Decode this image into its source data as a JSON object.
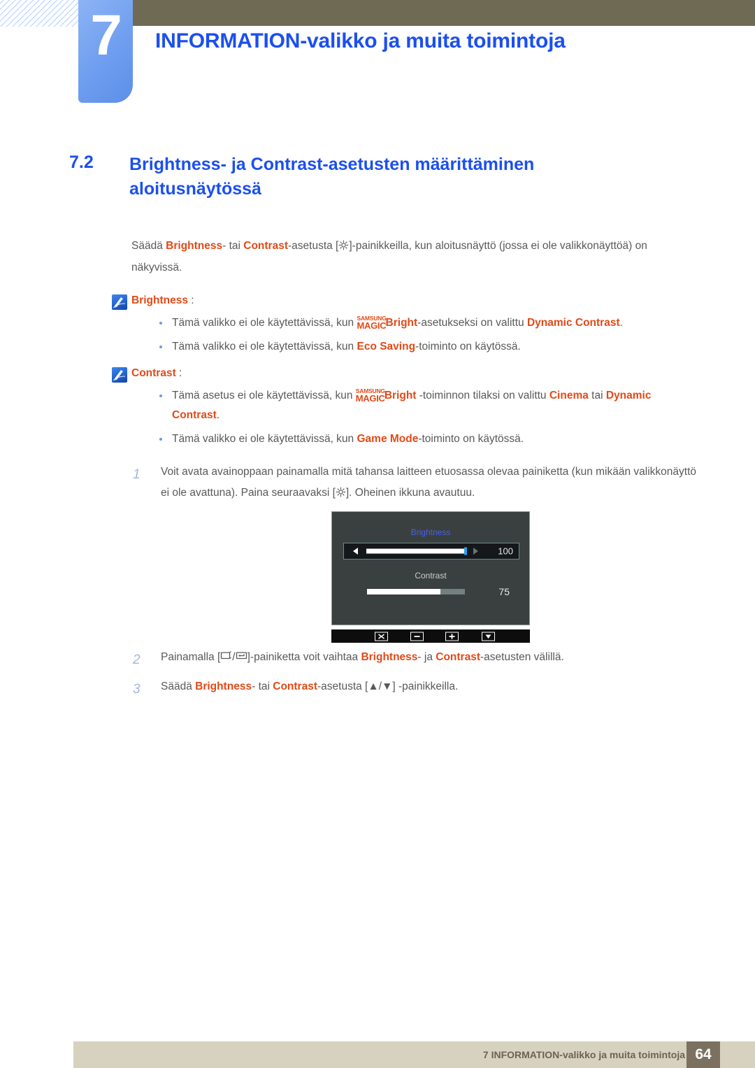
{
  "header": {
    "chapter_number": "7",
    "chapter_title": "INFORMATION-valikko ja muita toimintoja"
  },
  "section": {
    "number": "7.2",
    "title": "Brightness- ja Contrast-asetusten määrittäminen aloitusnäytössä"
  },
  "intro": {
    "p1_a": "Säädä ",
    "p1_b": "Brightness",
    "p1_c": "- tai ",
    "p1_d": "Contrast",
    "p1_e": "-asetusta [",
    "p1_f": "]-painikkeilla, kun aloitusnäyttö (jossa ei ole valikkonäyttöä) on näkyvissä."
  },
  "notes": [
    {
      "icon": "note-pen-icon",
      "title": "Brightness",
      "title_suffix": " :",
      "bullets": [
        {
          "a": "Tämä valikko ei ole käytettävissä, kun ",
          "magic_top": "SAMSUNG",
          "magic_bottom": "MAGIC",
          "magic_word": "Bright",
          "b": "-asetukseksi on valittu ",
          "c": "Dynamic Contrast",
          "d": "."
        },
        {
          "a": "Tämä valikko ei ole käytettävissä, kun ",
          "c": "Eco Saving",
          "d": "-toiminto on käytössä."
        }
      ]
    },
    {
      "icon": "note-pen-icon",
      "title": "Contrast",
      "title_suffix": " :",
      "bullets": [
        {
          "a": "Tämä asetus ei ole käytettävissä, kun ",
          "magic_top": "SAMSUNG",
          "magic_bottom": "MAGIC",
          "magic_word": "Bright",
          "b": " -toiminnon tilaksi on valittu ",
          "c": "Cinema",
          "d": " tai ",
          "e": "Dynamic Contrast",
          "f": "."
        },
        {
          "a": "Tämä valikko ei ole käytettävissä, kun ",
          "c": "Game Mode",
          "d": "-toiminto on käytössä."
        }
      ]
    }
  ],
  "steps": [
    {
      "num": "1",
      "a": "Voit avata avainoppaan painamalla mitä tahansa laitteen etuosassa olevaa painiketta (kun mikään valikkonäyttö ei ole avattuna). Paina seuraavaksi [",
      "b": "]. Oheinen ikkuna avautuu."
    },
    {
      "num": "2",
      "a": "Painamalla [",
      "slash": "/",
      "b": "]-painiketta voit vaihtaa ",
      "c": "Brightness",
      "d": "- ja ",
      "e": "Contrast",
      "f": "-asetusten välillä."
    },
    {
      "num": "3",
      "a": "Säädä ",
      "c": "Brightness",
      "d": "- tai ",
      "e": "Contrast",
      "f": "-asetusta [",
      "up": "▲",
      "slash": "/",
      "down": "▼",
      "g": "] -painikkeilla."
    }
  ],
  "osd": {
    "brightness_label": "Brightness",
    "brightness_value": "100",
    "contrast_label": "Contrast",
    "contrast_value": "75",
    "toolbar_buttons": [
      "close-icon",
      "minus-icon",
      "plus-icon",
      "down-arrow-icon"
    ]
  },
  "footer": {
    "text": "7 INFORMATION-valikko ja muita toimintoja",
    "page": "64"
  },
  "colors": {
    "accent_blue": "#1b4ff0",
    "accent_orange": "#e24a17",
    "olive": "#6e6a54",
    "footer_beige": "#d7d2bf",
    "footer_page_bg": "#7c7161",
    "tab_blue": "#6f9ef0",
    "body_text": "#58595b"
  }
}
